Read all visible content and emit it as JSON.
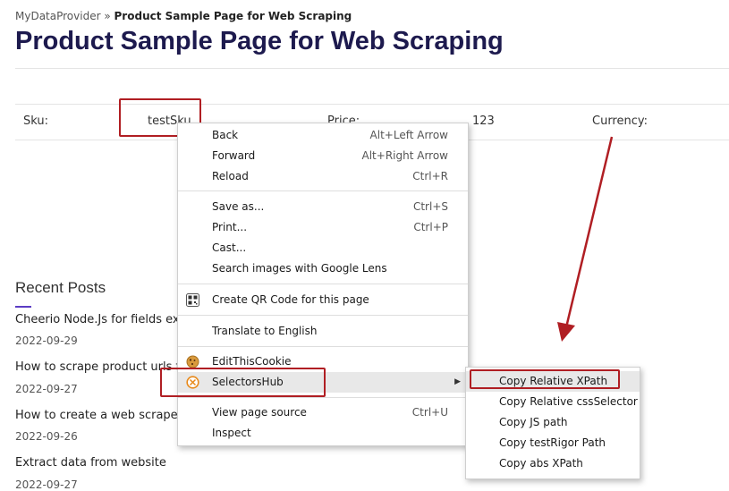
{
  "breadcrumb": {
    "site": "MyDataProvider",
    "separator": "»",
    "current": "Product Sample Page for Web Scraping"
  },
  "page_title": "Product Sample Page for Web Scraping",
  "product_row": {
    "sku_label": "Sku:",
    "sku_value": "testSku",
    "price_label": "Price:",
    "price_value": "123",
    "currency_label": "Currency:"
  },
  "recent_posts": {
    "title": "Recent Posts",
    "posts": [
      {
        "title": "Cheerio Node.Js for fields extr",
        "date": "2022-09-29"
      },
      {
        "title": "How to scrape product urls fr",
        "date": "2022-09-27"
      },
      {
        "title": "How to create a web scraper u",
        "date": "2022-09-26"
      },
      {
        "title": "Extract data from website",
        "date": "2022-09-27"
      }
    ]
  },
  "context_menu": {
    "items": [
      {
        "label": "Back",
        "shortcut": "Alt+Left Arrow"
      },
      {
        "label": "Forward",
        "shortcut": "Alt+Right Arrow"
      },
      {
        "label": "Reload",
        "shortcut": "Ctrl+R"
      },
      {
        "label": "Save as...",
        "shortcut": "Ctrl+S"
      },
      {
        "label": "Print...",
        "shortcut": "Ctrl+P"
      },
      {
        "label": "Cast...",
        "shortcut": ""
      },
      {
        "label": "Search images with Google Lens",
        "shortcut": ""
      },
      {
        "label": "Create QR Code for this page",
        "shortcut": "",
        "icon": "qr-code-icon"
      },
      {
        "label": "Translate to English",
        "shortcut": ""
      },
      {
        "label": "EditThisCookie",
        "shortcut": "",
        "icon": "cookie-icon"
      },
      {
        "label": "SelectorsHub",
        "shortcut": "",
        "icon": "selectorshub-icon",
        "submenu_arrow": "▶"
      },
      {
        "label": "View page source",
        "shortcut": "Ctrl+U"
      },
      {
        "label": "Inspect",
        "shortcut": ""
      }
    ]
  },
  "submenu": {
    "items": [
      {
        "label": "Copy Relative XPath"
      },
      {
        "label": "Copy Relative cssSelector"
      },
      {
        "label": "Copy JS path"
      },
      {
        "label": "Copy testRigor Path"
      },
      {
        "label": "Copy abs XPath"
      }
    ]
  },
  "colors": {
    "title": "#1d1a4e",
    "annotation": "#b01e23",
    "accent": "#5b3cc4",
    "highlight": "#e8e8e8"
  }
}
